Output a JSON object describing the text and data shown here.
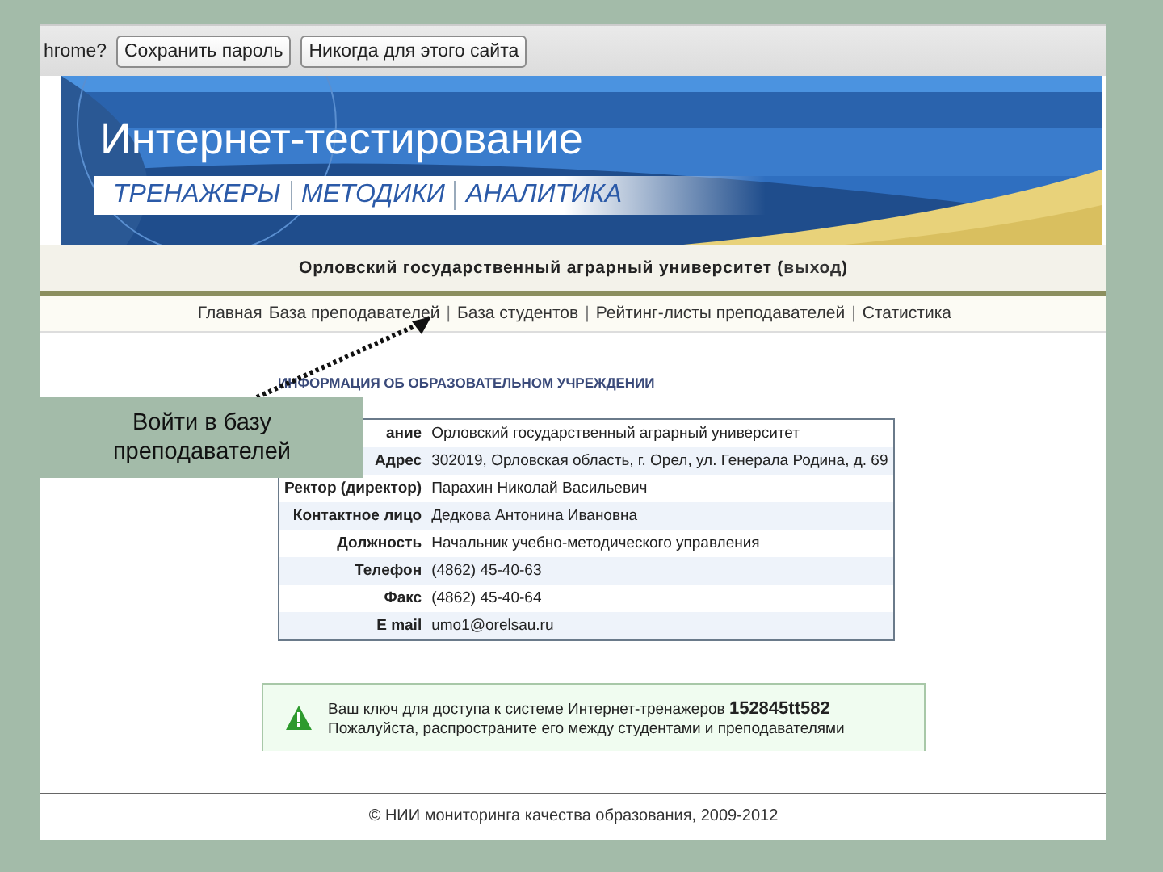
{
  "infobar": {
    "question": "hrome?",
    "buttons": [
      "Сохранить пароль",
      "Никогда для этого сайта"
    ]
  },
  "banner": {
    "title": "Интернет-тестирование",
    "tabs": [
      "ТРЕНАЖЕРЫ",
      "МЕТОДИКИ",
      "АНАЛИТИКА"
    ]
  },
  "university": {
    "before": "Орловский государственный аграрный университет (",
    "link": "выход",
    "after": ")"
  },
  "nav": [
    {
      "kind": "link",
      "label": "Главная"
    },
    {
      "kind": "link",
      "label": "База преподавателей"
    },
    {
      "kind": "separator",
      "label": "|"
    },
    {
      "kind": "link",
      "label": "База студентов"
    },
    {
      "kind": "separator",
      "label": "|"
    },
    {
      "kind": "link",
      "label": "Рейтинг-листы преподавателей"
    },
    {
      "kind": "separator",
      "label": "|"
    },
    {
      "kind": "link",
      "label": "Статистика"
    }
  ],
  "info": {
    "heading": "ИНФОРМАЦИЯ ОБ ОБРАЗОВАТЕЛЬНОМ УЧРЕЖДЕНИИ",
    "rows": [
      {
        "label": "ание",
        "value": "Орловский государственный аграрный университет"
      },
      {
        "label": "Адрес",
        "value": "302019, Орловская область, г. Орел, ул. Генерала Родина, д. 69"
      },
      {
        "label": "Ректор (директор)",
        "value": "Парахин Николай Васильевич"
      },
      {
        "label": "Контактное лицо",
        "value": "Дедкова Антонина Ивановна"
      },
      {
        "label": "Должность",
        "value": "Начальник учебно-методического управления"
      },
      {
        "label": "Телефон",
        "value": "(4862) 45-40-63"
      },
      {
        "label": "Факс",
        "value": "(4862) 45-40-64"
      },
      {
        "label": "E mail",
        "value": "umo1@orelsau.ru"
      }
    ]
  },
  "notice": {
    "lines": [
      "Ваш ключ для доступа к системе Интернет-тренажеров **152845tt582**",
      "Пожалуйста, распространите его между студентами и преподавателями"
    ]
  },
  "footer": "© НИИ мониторинга качества образования, 2009-2012",
  "callout": "Войти в базу преподавателей"
}
